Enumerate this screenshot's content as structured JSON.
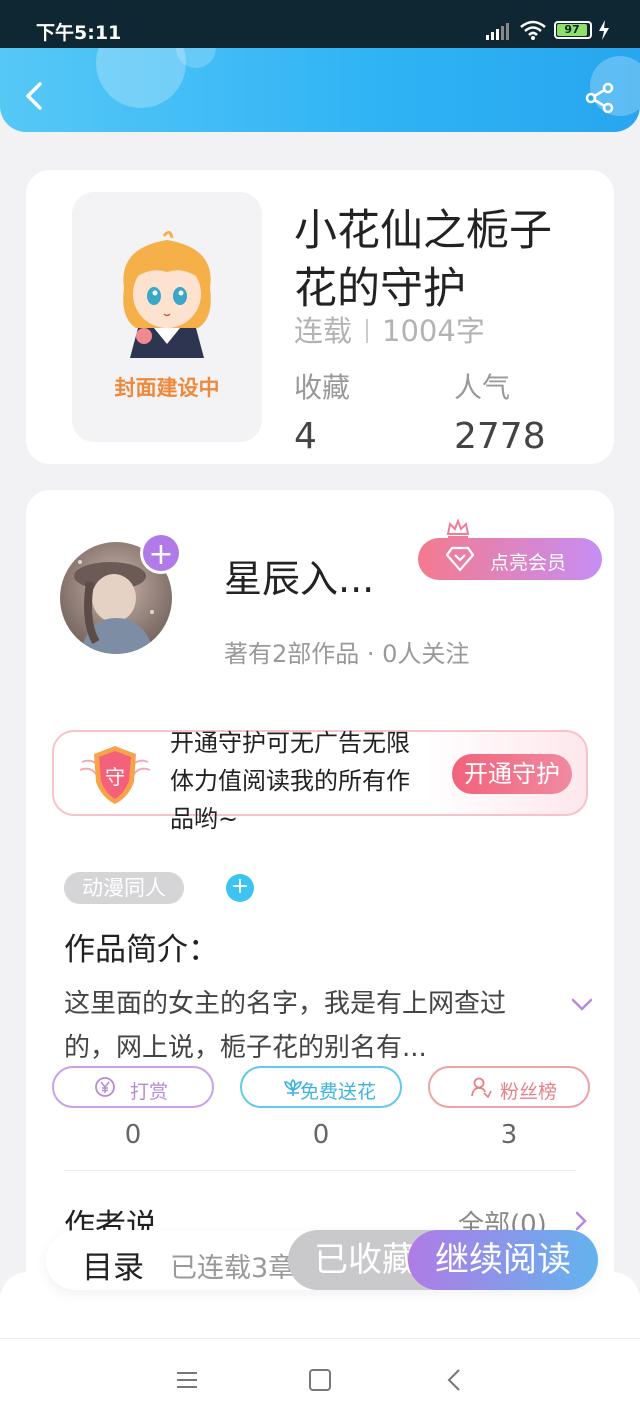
{
  "status_bar": {
    "time": "下午5:11",
    "battery": "97"
  },
  "book": {
    "cover_text": "封面建设中",
    "title": "小花仙之栀子花的守护",
    "status": "连载",
    "word_count": "1004字",
    "favorites_label": "收藏",
    "favorites_value": "4",
    "popularity_label": "人气",
    "popularity_value": "2778"
  },
  "author": {
    "name": "星辰入...",
    "stats": "著有2部作品 · 0人关注",
    "vip_label": "点亮会员"
  },
  "guard": {
    "shield_glyph": "守",
    "text": "开通守护可无广告无限体力值阅读我的所有作品哟~",
    "button": "开通守护"
  },
  "tag": {
    "label": "动漫同人"
  },
  "intro": {
    "title": "作品简介：",
    "text": "这里面的女主的名字，我是有上网查过的，网上说，栀子花的别名有..."
  },
  "actions": [
    {
      "label": "打赏",
      "count": "0",
      "icon": "yen-coin-icon",
      "color": "#b78ad9"
    },
    {
      "label": "免费送花",
      "count": "0",
      "icon": "flower-icon",
      "color": "#3db4df"
    },
    {
      "label": "粉丝榜",
      "count": "3",
      "icon": "user-icon",
      "color": "#e58289"
    }
  ],
  "author_say": {
    "title": "作者说",
    "all_link": "全部(0)"
  },
  "bottom_bar": {
    "toc": "目录",
    "toc_status": "已连载3章",
    "collected": "已收藏",
    "continue": "继续阅读"
  },
  "colors": {
    "header_blue": "#2fb3f5",
    "accent_purple": "#b07be6",
    "guard_pink": "#f1627b",
    "cover_text_orange": "#f0883a"
  }
}
